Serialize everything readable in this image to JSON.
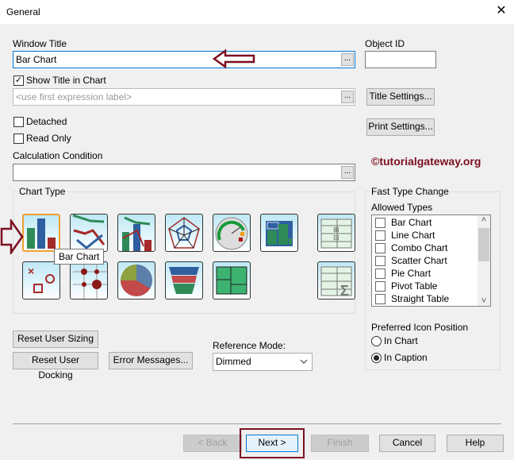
{
  "window": {
    "title": "General",
    "close": "✕"
  },
  "window_title": {
    "label": "Window Title",
    "value": "Bar Chart",
    "browse": "..."
  },
  "object_id": {
    "label": "Object ID",
    "value": ""
  },
  "show_title": {
    "label": "Show Title in Chart",
    "checked": true,
    "check": "✓"
  },
  "title_expr": {
    "placeholder": "<use first expression label>",
    "browse": "..."
  },
  "buttons": {
    "title_settings": "Title Settings...",
    "print_settings": "Print Settings...",
    "reset_sizing": "Reset User Sizing",
    "reset_docking": "Reset User Docking",
    "error_messages": "Error Messages...",
    "back": "< Back",
    "next": "Next >",
    "finish": "Finish",
    "cancel": "Cancel",
    "help": "Help"
  },
  "detached": {
    "label": "Detached",
    "checked": false
  },
  "read_only": {
    "label": "Read Only",
    "checked": false
  },
  "watermark": "©tutorialgateway.org",
  "calc_condition": {
    "label": "Calculation Condition",
    "value": "",
    "browse": "..."
  },
  "chart_type": {
    "label": "Chart Type",
    "tooltip": "Bar Chart",
    "selected": "Bar Chart"
  },
  "fast_type": {
    "label": "Fast Type Change",
    "allowed_label": "Allowed Types",
    "items": [
      "Bar Chart",
      "Line Chart",
      "Combo Chart",
      "Scatter Chart",
      "Pie Chart",
      "Pivot Table",
      "Straight Table"
    ],
    "scroll_up": "˄",
    "scroll_down": "˅"
  },
  "icon_position": {
    "label": "Preferred Icon Position",
    "options": [
      "In Chart",
      "In Caption"
    ],
    "selected": "In Caption"
  },
  "reference_mode": {
    "label": "Reference Mode:",
    "value": "Dimmed"
  },
  "colors": {
    "annotation": "#7b0f1f",
    "focus": "#0078d7"
  }
}
